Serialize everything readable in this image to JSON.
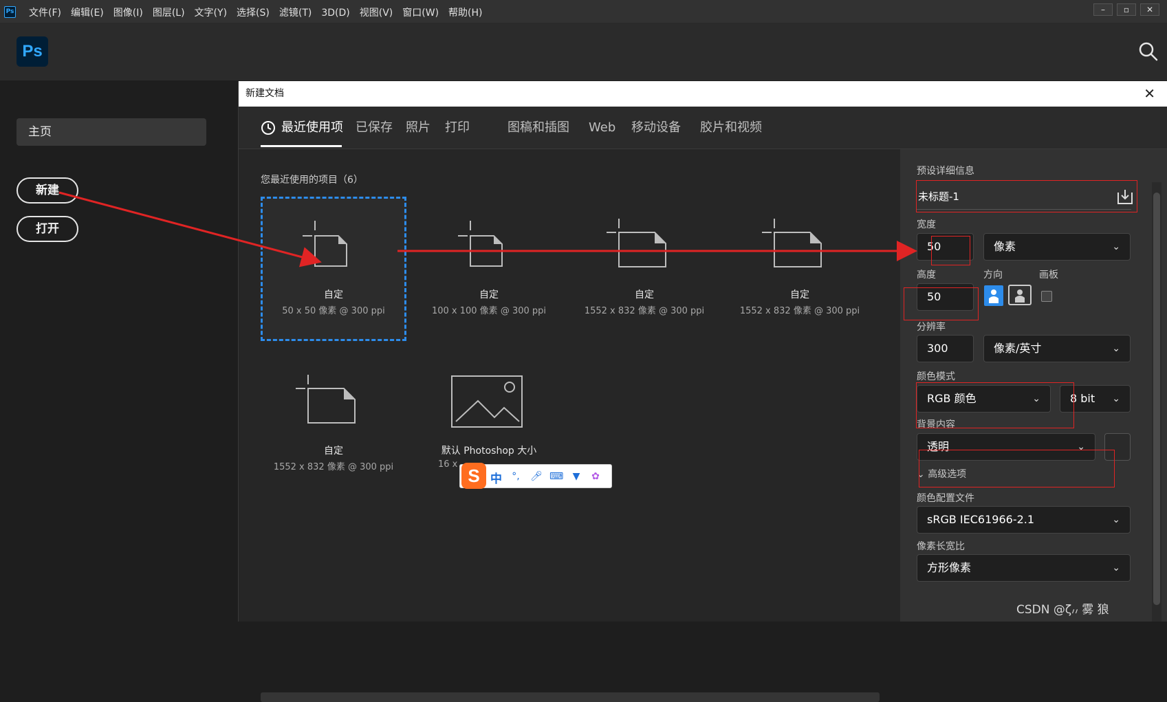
{
  "menubar": {
    "app_badge": "Ps",
    "items": [
      "文件(F)",
      "编辑(E)",
      "图像(I)",
      "图层(L)",
      "文字(Y)",
      "选择(S)",
      "滤镜(T)",
      "3D(D)",
      "视图(V)",
      "窗口(W)",
      "帮助(H)"
    ]
  },
  "header": {
    "logo": "Ps"
  },
  "leftpanel": {
    "home_label": "主页",
    "new_label": "新建",
    "open_label": "打开"
  },
  "dialog": {
    "title": "新建文档",
    "tabs": [
      "最近使用项",
      "已保存",
      "照片",
      "打印",
      "图稿和插图",
      "Web",
      "移动设备",
      "胶片和视频"
    ],
    "recent_title": "您最近使用的项目（6）",
    "presets": [
      {
        "name": "自定",
        "size": "50 x 50 像素 @ 300 ppi"
      },
      {
        "name": "自定",
        "size": "100 x 100 像素 @ 300 ppi"
      },
      {
        "name": "自定",
        "size": "1552 x 832 像素 @ 300 ppi"
      },
      {
        "name": "自定",
        "size": "1552 x 832 像素 @ 300 ppi"
      },
      {
        "name": "自定",
        "size": "1552 x 832 像素 @ 300 ppi"
      },
      {
        "name": "默认 Photoshop 大小",
        "size": "16 x"
      }
    ],
    "details": {
      "section_title": "预设详细信息",
      "doc_name": "未标题-1",
      "width_label": "宽度",
      "width_value": "50",
      "width_unit": "像素",
      "height_label": "高度",
      "height_value": "50",
      "orientation_label": "方向",
      "artboard_label": "画板",
      "resolution_label": "分辨率",
      "resolution_value": "300",
      "resolution_unit": "像素/英寸",
      "color_mode_label": "颜色模式",
      "color_mode_value": "RGB 颜色",
      "bit_depth": "8 bit",
      "background_label": "背景内容",
      "background_value": "透明",
      "advanced_label": "高级选项",
      "profile_label": "颜色配置文件",
      "profile_value": "sRGB IEC61966-2.1",
      "pixel_aspect_label": "像素长宽比",
      "pixel_aspect_value": "方形像素"
    }
  },
  "ime": {
    "mode": "中",
    "punct": "°,"
  },
  "watermark": "CSDN @ζ៸៸ 雾 狼 ",
  "colors": {
    "accent": "#2d8ceb",
    "annotation": "#e02424",
    "ps_blue": "#31a8ff"
  }
}
